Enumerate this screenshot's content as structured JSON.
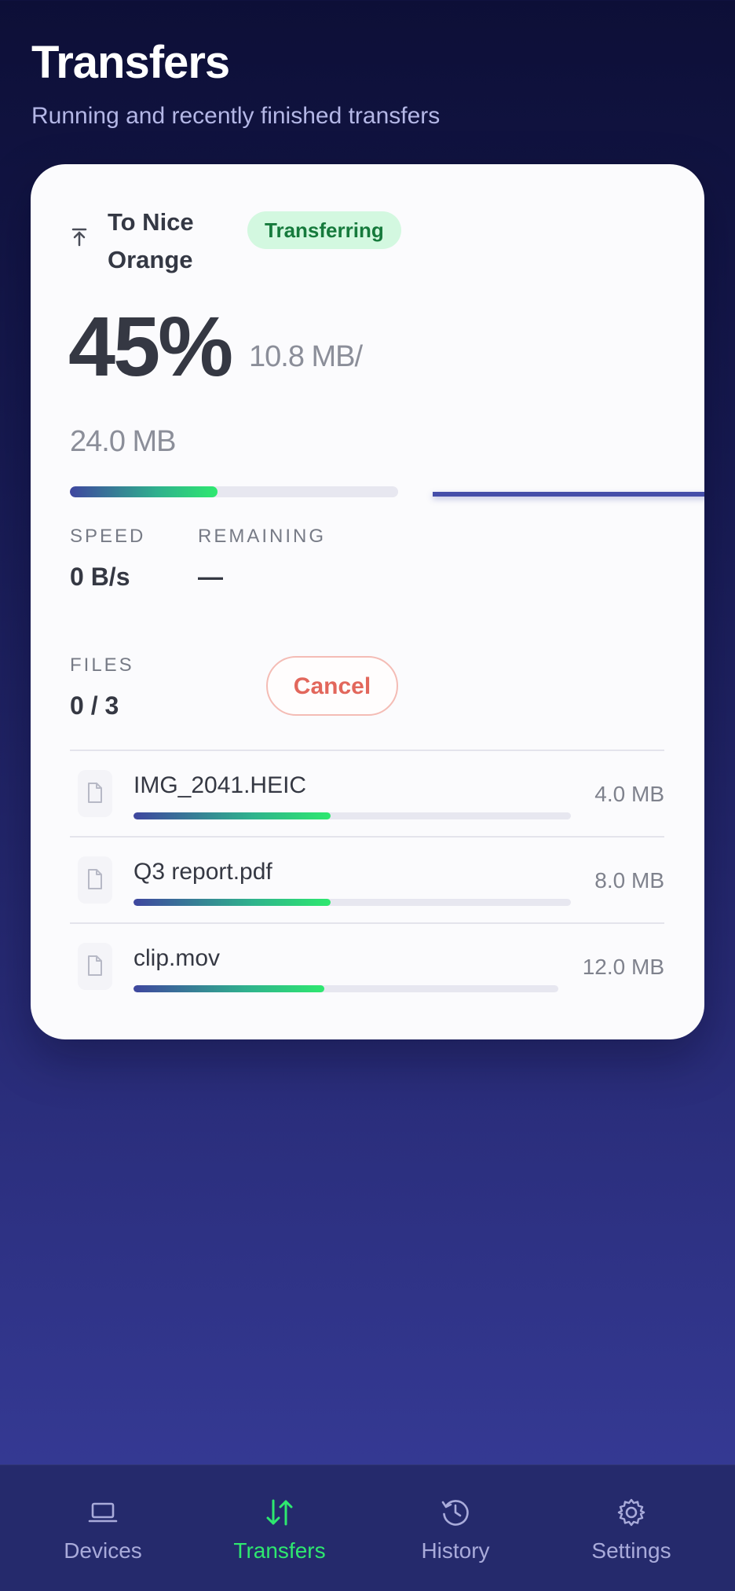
{
  "header": {
    "title": "Transfers",
    "subtitle": "Running and recently finished transfers"
  },
  "transfer": {
    "direction_icon": "upload-arrow-icon",
    "destination": "To Nice Orange",
    "status": "Transferring",
    "percent_label": "45%",
    "progress": 0.45,
    "sent": "10.8 MB/",
    "total": "24.0 MB",
    "speed_label": "SPEED",
    "speed_value": "0 B/s",
    "remaining_label": "REMAINING",
    "remaining_value": "—",
    "files_label": "FILES",
    "files_value": "0 / 3",
    "cancel_label": "Cancel",
    "files": [
      {
        "name": "IMG_2041.HEIC",
        "size": "4.0 MB",
        "progress": 0.45,
        "icon": "file-icon"
      },
      {
        "name": "Q3 report.pdf",
        "size": "8.0 MB",
        "progress": 0.45,
        "icon": "file-icon"
      },
      {
        "name": "clip.mov",
        "size": "12.0 MB",
        "progress": 0.45,
        "icon": "file-icon"
      }
    ]
  },
  "nav": {
    "items": [
      {
        "label": "Devices",
        "icon": "laptop-icon"
      },
      {
        "label": "Transfers",
        "icon": "transfer-arrows-icon",
        "active": true
      },
      {
        "label": "History",
        "icon": "history-icon"
      },
      {
        "label": "Settings",
        "icon": "gear-icon"
      }
    ]
  },
  "colors": {
    "accent_green": "#2ee86f",
    "badge_bg": "#d3f8e0",
    "badge_text": "#167a3c",
    "cancel": "#e2675c",
    "nav_bg": "#252a6c"
  }
}
